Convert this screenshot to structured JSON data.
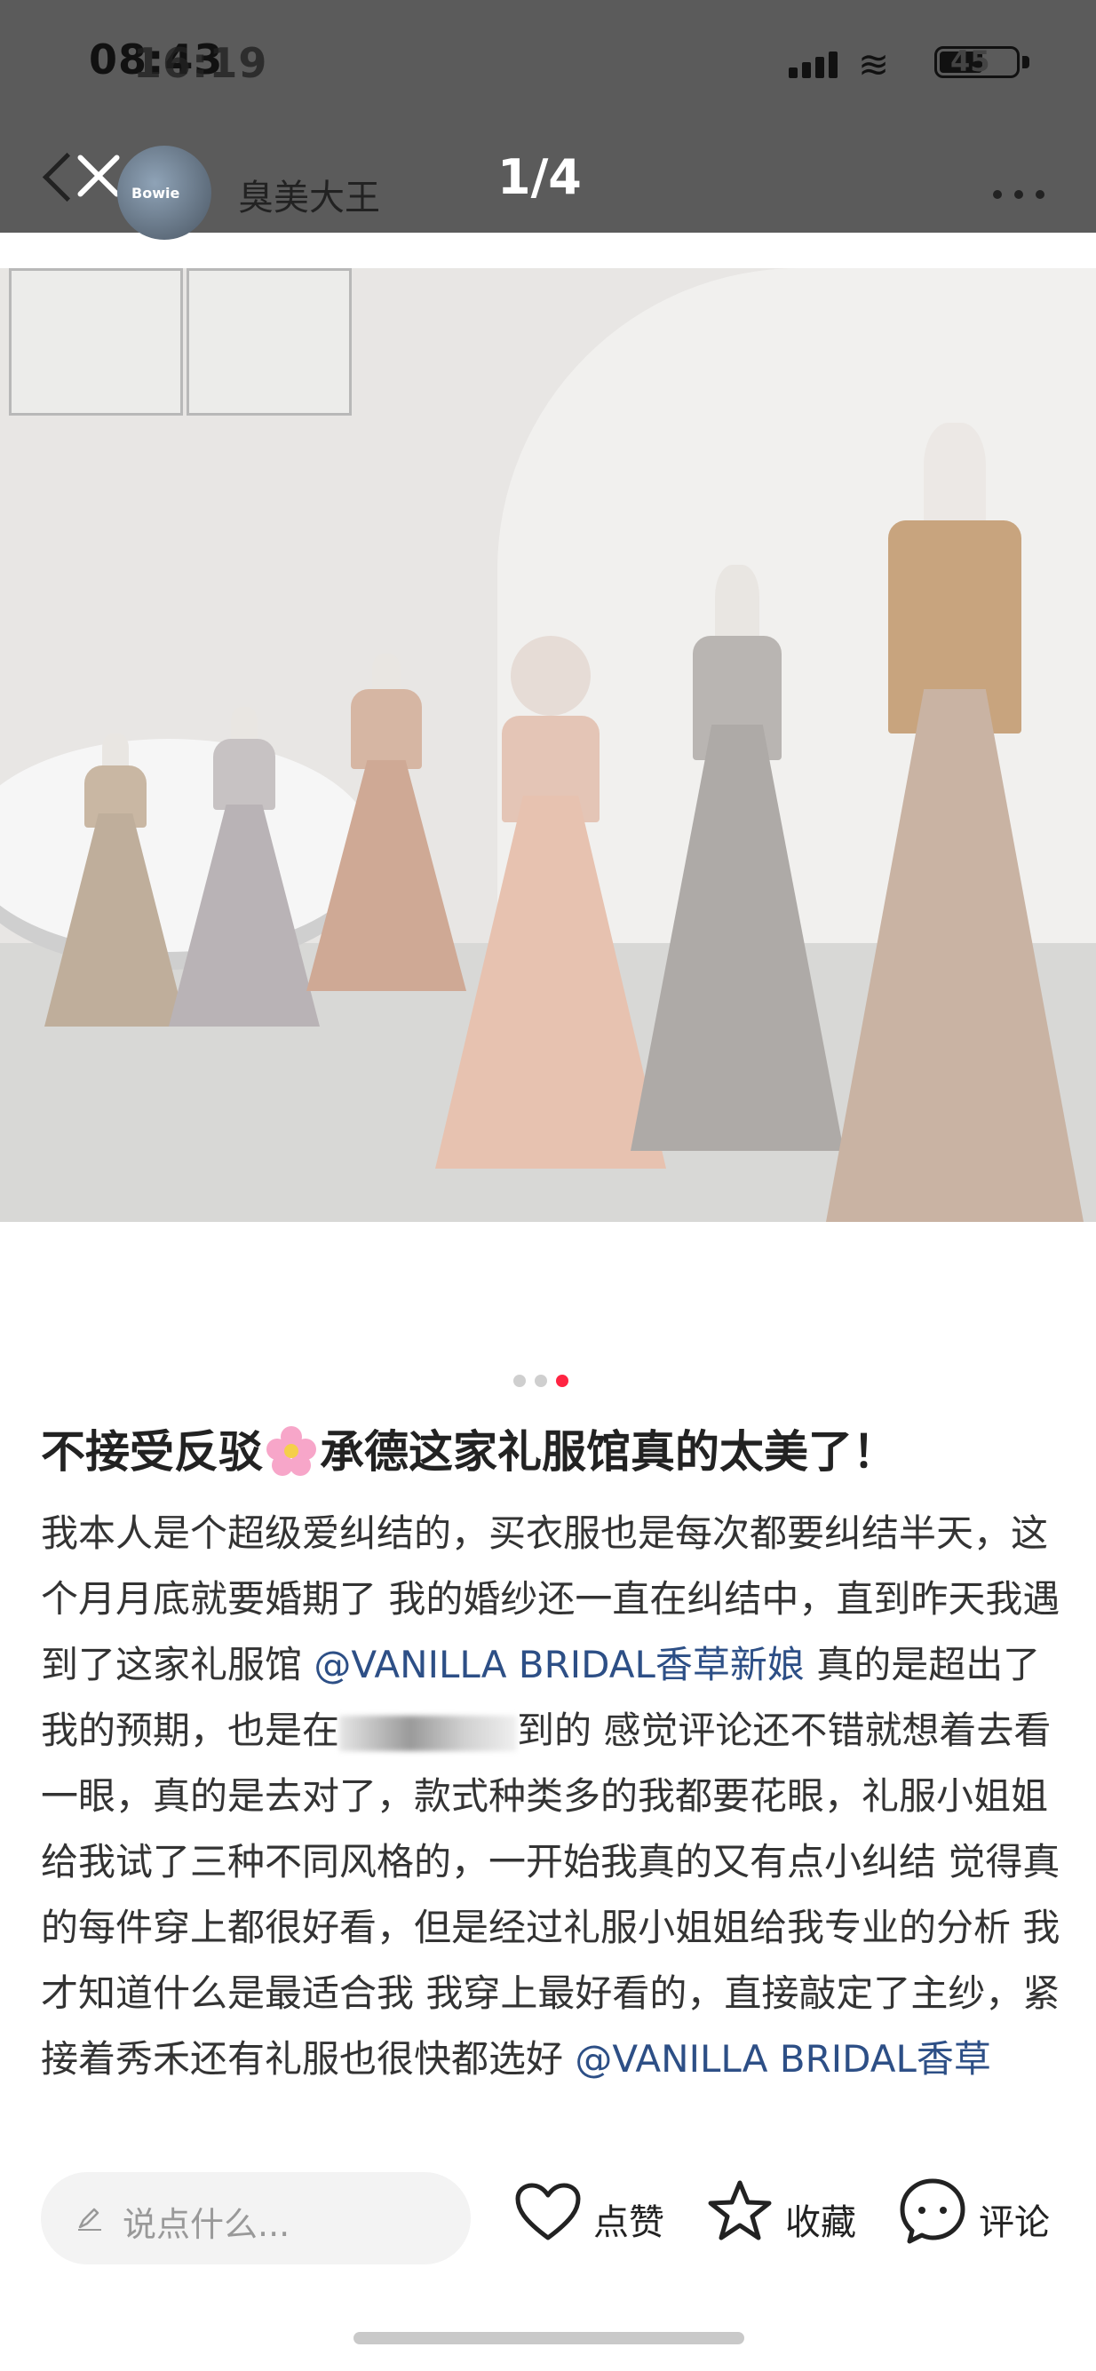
{
  "status_bar": {
    "time": "08:43",
    "time_overlay": "16:19",
    "battery": "45"
  },
  "header": {
    "username": "臭美大王",
    "avatar_text": "Bowie",
    "page_indicator": "1/4"
  },
  "carousel": {
    "total_dots": 3,
    "active_dot": 3
  },
  "post": {
    "title_part1": "不接受反驳",
    "title_emoji": "cherry-blossom-icon",
    "title_part2": "承德这家礼服馆真的太美了！",
    "body_1": "我本人是个超级爱纠结的，买衣服也是每次都要纠结半天，这个月月底就要婚期了 我的婚纱还一直在纠结中，直到昨天我遇到了这家礼服馆",
    "mention_1": "@VANILLA BRIDAL香草新娘",
    "body_2": " 真的是超出了我的预期，也是在",
    "body_3": "到的 感觉评论还不错就想着去看一眼，真的是去对了，款式种类多的我都要花眼，礼服小姐姐给我试了三种不同风格的，一开始我真的又有点小纠结 觉得真的每件穿上都很好看，但是经过礼服小姐姐给我专业的分析 我才知道什么是最适合我 我穿上最好看的，直接敲定了主纱，紧接着秀禾还有礼服也很快都选好",
    "mention_2": "@VANILLA BRIDAL香草"
  },
  "bottom_bar": {
    "comment_placeholder": "说点什么...",
    "like_label": "点赞",
    "collect_label": "收藏",
    "comment_label": "评论"
  },
  "colors": {
    "accent": "#ff2442",
    "mention": "#2d4f86",
    "overlay": "#5b5b5b"
  }
}
